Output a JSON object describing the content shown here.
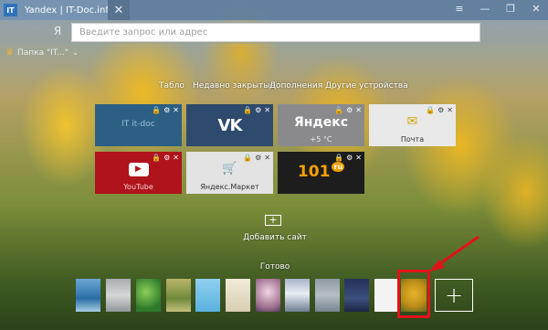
{
  "titlebar": {
    "favicon_text": "IT",
    "tab_title": "Yandex | IT-Doc.info",
    "close_glyph": "✕",
    "controls": [
      "≡",
      "—",
      "❐",
      "✕"
    ]
  },
  "omnibox": {
    "logo": "Я",
    "placeholder": "Введите запрос или адрес"
  },
  "bookmarks": {
    "folder_label": "Папка \"IT...\""
  },
  "nav": {
    "tabs": [
      "Табло",
      "Недавно закрытые",
      "Дополнения",
      "Другие устройства"
    ]
  },
  "tiles": [
    {
      "name": "",
      "logo": "IT  it-doc",
      "bg": "#2c5f83"
    },
    {
      "name": "",
      "logo": "VK",
      "bg": "#2e4a6c"
    },
    {
      "name": "",
      "logo": "Яндекс",
      "sub": "+5 °С",
      "bg": "#8a8a8c"
    },
    {
      "name": "Почта",
      "logo": "✉",
      "bg": "#e9e9e9"
    },
    {
      "name": "YouTube",
      "logo": "▶",
      "bg": "#b0131b"
    },
    {
      "name": "Яндекс.Маркет",
      "logo": "🛒",
      "bg": "#e3e3e3"
    },
    {
      "name": "",
      "logo": "101",
      "sub": "ru",
      "bg": "#1d1d1d"
    }
  ],
  "tile_tools": [
    "🔒",
    "⚙",
    "✕"
  ],
  "add_site": {
    "icon": "+",
    "label": "Добавить сайт"
  },
  "done_label": "Готово",
  "backgrounds": {
    "thumbs": [
      "sea",
      "mist",
      "leaves",
      "meadow",
      "sky",
      "sand",
      "blossom",
      "mountains",
      "rain",
      "night",
      "white",
      "tulips"
    ],
    "selected_index": 11,
    "add_icon": "+"
  },
  "colors": {
    "accent_red": "#e0141a",
    "titlebar": "#607e9c"
  }
}
